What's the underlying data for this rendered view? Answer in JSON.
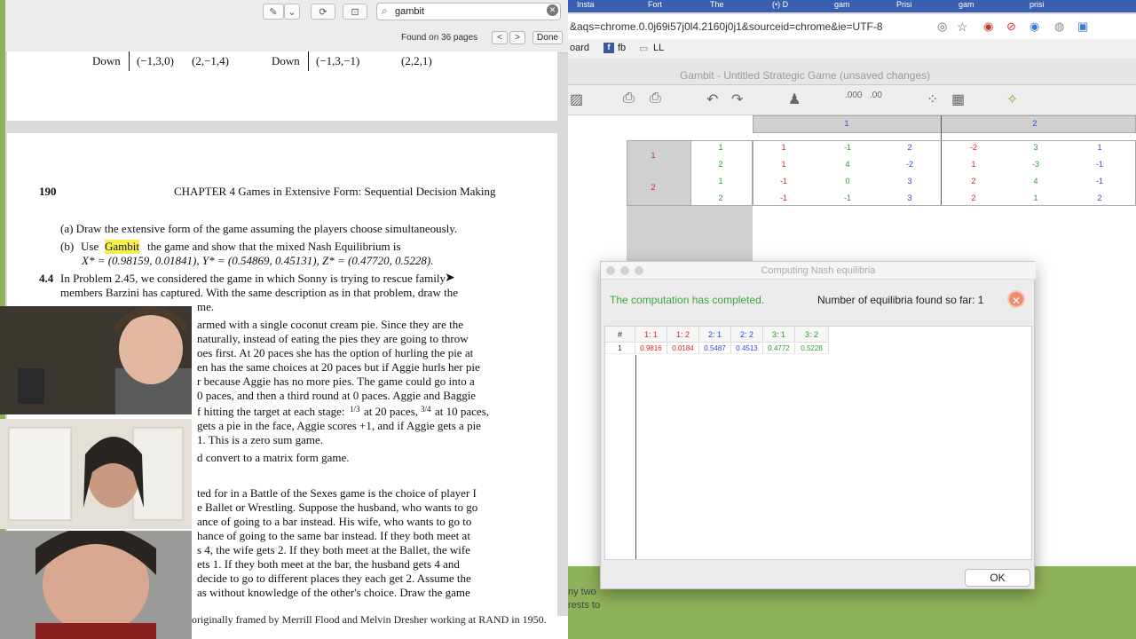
{
  "pdf": {
    "search_value": "gambit",
    "found_text": "Found on 36 pages",
    "prev_label": "<",
    "next_label": ">",
    "done_label": "Done",
    "top_page": {
      "row_label1": "Down",
      "cell1": "(−1,3,0)",
      "cell2": "(2,−1,4)",
      "row_label2": "Down",
      "cell3": "(−1,3,−1)",
      "cell4": "(2,2,1)"
    },
    "page_number": "190",
    "chapter_header": "CHAPTER 4  Games in Extensive Form: Sequential Decision Making",
    "lines": [
      "(a)  Draw the extensive form of the game assuming the players choose simultaneously.",
      "the game and show that the mixed Nash Equilibrium is",
      "X* = (0.98159, 0.01841), Y* = (0.54869, 0.45131), Z* = (0.47720, 0.5228).",
      "In Problem 2.45, we considered the game in which Sonny is trying to rescue family",
      "members Barzini has captured. With the same description as in that problem, draw the",
      "armed with a single coconut cream pie. Since they are the",
      "naturally, instead of eating the pies they are going to throw",
      "oes first. At 20 paces she has the option of hurling the pie at",
      "en has the same choices at 20 paces but if Aggie hurls her pie",
      "r because Aggie has no more pies. The game could go into a",
      "0 paces, and then a third round at 0 paces. Aggie and Baggie",
      "f hitting the target at each stage:",
      "at 20 paces,",
      "at 10 paces,",
      "gets a pie in the face, Aggie scores +1, and if Aggie gets a pie",
      "1. This is a zero sum game.",
      "d convert to a matrix form game.",
      "ted for in a Battle of the Sexes game is the choice of player I",
      "e Ballet or Wrestling. Suppose the husband, who wants to go",
      "ance of going to a bar instead. His wife, who wants to go to",
      "hance of going to the same bar instead. If they both meet at",
      "s 4, the wife gets 2. If they both meet at the Ballet, the wife",
      "ets 1. If they both meet at the bar, the husband gets 4 and",
      "decide to go to different places they each get 2. Assume the",
      "as without knowledge of the other's choice. Draw the game"
    ],
    "item_b_label": "(b)",
    "item_b_use": "Use",
    "item_b_highlight": "Gambit",
    "problem_number": "4.4",
    "line_me": "me.",
    "frac1": "1/3",
    "frac2": "3/4",
    "bottom_line": "originally framed by Merrill Flood and Melvin Dresher working at RAND in 1950."
  },
  "chrome": {
    "tabs": [
      "Insta",
      "Fort",
      "The",
      "(•) D",
      "gam",
      "Prisi",
      "gam",
      "prisi"
    ],
    "url": "&aqs=chrome.0.0j69i57j0l4.2160j0j1&sourceid=chrome&ie=UTF-8",
    "bookmarks": [
      "oard",
      "fb",
      "LL"
    ]
  },
  "gambit": {
    "window_title": "Gambit - Untitled Strategic Game (unsaved changes)",
    "col_players": [
      "1",
      "2"
    ],
    "row_players": [
      "1",
      "2"
    ],
    "strategy_labels": [
      "1",
      "2",
      "1",
      "2"
    ],
    "payoffs": [
      [
        "1",
        "-1",
        "2",
        "-2",
        "3",
        "1"
      ],
      [
        "1",
        "4",
        "-2",
        "1",
        "-3",
        "-1"
      ],
      [
        "-1",
        "0",
        "3",
        "2",
        "4",
        "-1"
      ],
      [
        "-1",
        "-1",
        "3",
        "2",
        "1",
        "2"
      ]
    ],
    "bg_text": [
      "ny two",
      "rests to"
    ]
  },
  "dialog": {
    "title": "Computing Nash equilibria",
    "status": "The computation has completed.",
    "count": "Number of equilibria found so far: 1",
    "headers": [
      "#",
      "1: 1",
      "1: 2",
      "2: 1",
      "2: 2",
      "3: 1",
      "3: 2"
    ],
    "row": [
      "1",
      "0.9816",
      "0.0184",
      "0.5487",
      "0.4513",
      "0.4772",
      "0.5228"
    ],
    "ok_label": "OK"
  },
  "colors": {
    "player1": "#d22222",
    "player2": "#2b4ad8",
    "player3": "#2a9a2a",
    "highlight": "#f7ef52",
    "status_ok": "#3aa53a"
  }
}
